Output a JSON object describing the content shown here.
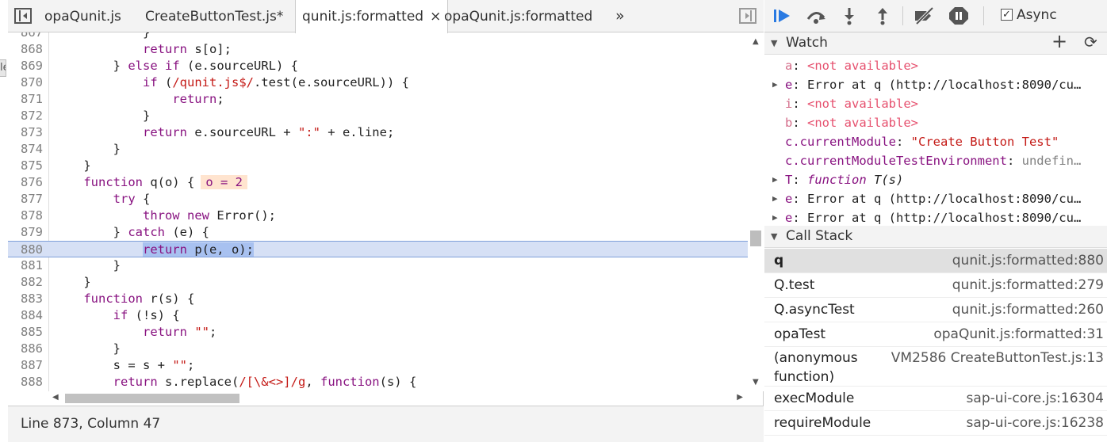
{
  "tabs": [
    {
      "label": "opaQunit.js",
      "active": false
    },
    {
      "label": "CreateButtonTest.js*",
      "active": false
    },
    {
      "label": "qunit.js:formatted",
      "active": true,
      "close": "×"
    },
    {
      "label": "opaQunit.js:formatted",
      "active": false
    }
  ],
  "tabs_overflow": "»",
  "editor": {
    "current_line": "880",
    "inline_value": "o = 2",
    "lines": [
      {
        "n": "867",
        "t": "            }"
      },
      {
        "n": "868",
        "t": "            return s[o];"
      },
      {
        "n": "869",
        "t": "        } else if (e.sourceURL) {"
      },
      {
        "n": "870",
        "t": "            if (/qunit.js$/.test(e.sourceURL)) {"
      },
      {
        "n": "871",
        "t": "                return;"
      },
      {
        "n": "872",
        "t": "            }"
      },
      {
        "n": "873",
        "t": "            return e.sourceURL + \":\" + e.line;"
      },
      {
        "n": "874",
        "t": "        }"
      },
      {
        "n": "875",
        "t": "    }"
      },
      {
        "n": "876",
        "t": "    function q(o) {"
      },
      {
        "n": "877",
        "t": "        try {"
      },
      {
        "n": "878",
        "t": "            throw new Error();"
      },
      {
        "n": "879",
        "t": "        } catch (e) {"
      },
      {
        "n": "880",
        "t": "            return p(e, o);"
      },
      {
        "n": "881",
        "t": "        }"
      },
      {
        "n": "882",
        "t": "    }"
      },
      {
        "n": "883",
        "t": "    function r(s) {"
      },
      {
        "n": "884",
        "t": "        if (!s) {"
      },
      {
        "n": "885",
        "t": "            return \"\";"
      },
      {
        "n": "886",
        "t": "        }"
      },
      {
        "n": "887",
        "t": "        s = s + \"\";"
      },
      {
        "n": "888",
        "t": "        return s.replace(/[\\&<>]/g, function(s) {"
      },
      {
        "n": "889",
        "t": ""
      }
    ]
  },
  "status": "Line 873, Column 47",
  "debugger": {
    "async_label": "Async",
    "async_checked": "✓",
    "icons": {
      "resume": "resume-icon",
      "step_over": "step-over-icon",
      "step_into": "step-into-icon",
      "step_out": "step-out-icon",
      "deactivate": "deactivate-breakpoints-icon",
      "pause_exceptions": "pause-on-exceptions-icon"
    }
  },
  "watch": {
    "title": "Watch",
    "add": "+",
    "refresh": "C",
    "items": [
      {
        "arrow": "",
        "name": "a",
        "sep": ": ",
        "value": "<not available>",
        "kind": "na"
      },
      {
        "arrow": "▶",
        "name": "e",
        "sep": ": ",
        "value": "Error at q (http://localhost:8090/cu…",
        "kind": "plain"
      },
      {
        "arrow": "",
        "name": "i",
        "sep": ": ",
        "value": "<not available>",
        "kind": "na"
      },
      {
        "arrow": "",
        "name": "b",
        "sep": ": ",
        "value": "<not available>",
        "kind": "na"
      },
      {
        "arrow": "",
        "name": "c.currentModule",
        "sep": ": ",
        "value": "\"Create Button Test\"",
        "kind": "str"
      },
      {
        "arrow": "",
        "name": "c.currentModuleTestEnvironment",
        "sep": ": ",
        "value": "undefin…",
        "kind": "undef"
      },
      {
        "arrow": "▶",
        "name": "T",
        "sep": ": ",
        "value": "function T(s)",
        "kind": "fn"
      },
      {
        "arrow": "▶",
        "name": "e",
        "sep": ": ",
        "value": "Error at q (http://localhost:8090/cu…",
        "kind": "plain"
      },
      {
        "arrow": "▶",
        "name": "e",
        "sep": ": ",
        "value": "Error at q (http://localhost:8090/cu…",
        "kind": "plain"
      }
    ]
  },
  "call_stack": {
    "title": "Call Stack",
    "frames": [
      {
        "name": "q",
        "location": "qunit.js:formatted:880",
        "current": true
      },
      {
        "name": "Q.test",
        "location": "qunit.js:formatted:279"
      },
      {
        "name": "Q.asyncTest",
        "location": "qunit.js:formatted:260"
      },
      {
        "name": "opaTest",
        "location": "opaQunit.js:formatted:31"
      },
      {
        "name": "(anonymous function)",
        "location": "VM2586 CreateButtonTest.js:13"
      },
      {
        "name": "execModule",
        "location": "sap-ui-core.js:16304"
      },
      {
        "name": "requireModule",
        "location": "sap-ui-core.js:16238"
      }
    ]
  }
}
